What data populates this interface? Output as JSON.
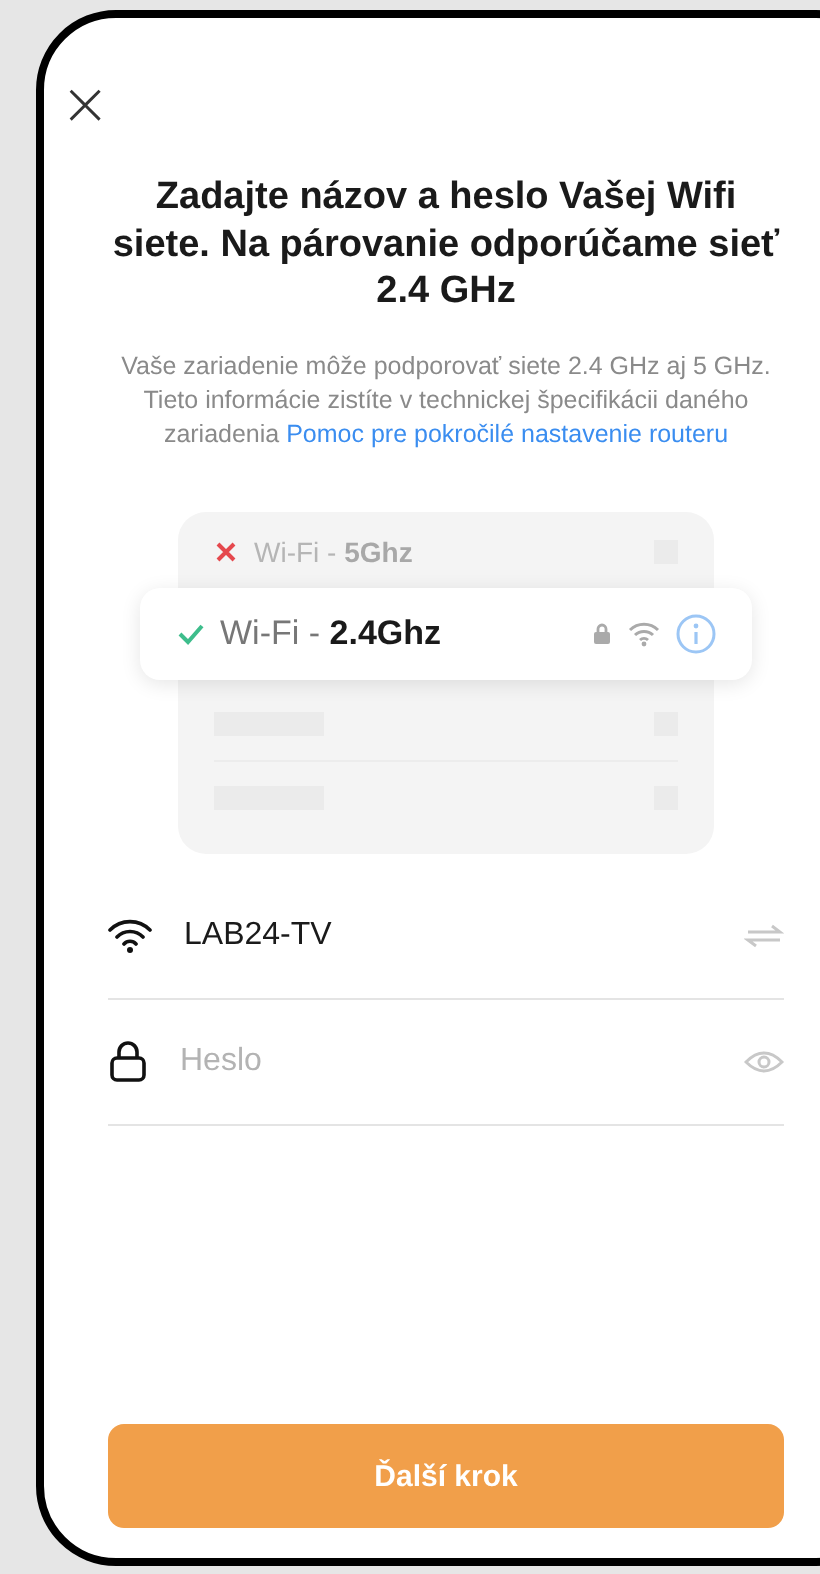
{
  "close": {
    "glyph": "×"
  },
  "title": "Zadajte názov a heslo Vašej Wifi siete. Na párovanie odporúčame sieť 2.4 GHz",
  "description": {
    "text": "Vaše zariadenie môže podporovať siete 2.4 GHz aj 5 GHz. Tieto informácie zistíte v technickej špecifikácii daného zariadenia",
    "link": "Pomoc pre pokročilé nastavenie routeru"
  },
  "illustration": {
    "networks": [
      {
        "kind": "unsupported",
        "prefix": "Wi-Fi - ",
        "band": "5Ghz"
      },
      {
        "kind": "supported",
        "prefix": "Wi-Fi - ",
        "band": "2.4Ghz"
      },
      {
        "kind": "placeholder"
      },
      {
        "kind": "placeholder"
      }
    ]
  },
  "fields": [
    {
      "kind": "network",
      "value": "LAB24-TV"
    },
    {
      "kind": "password",
      "placeholder": "Heslo"
    }
  ],
  "button": "Ďalší krok"
}
